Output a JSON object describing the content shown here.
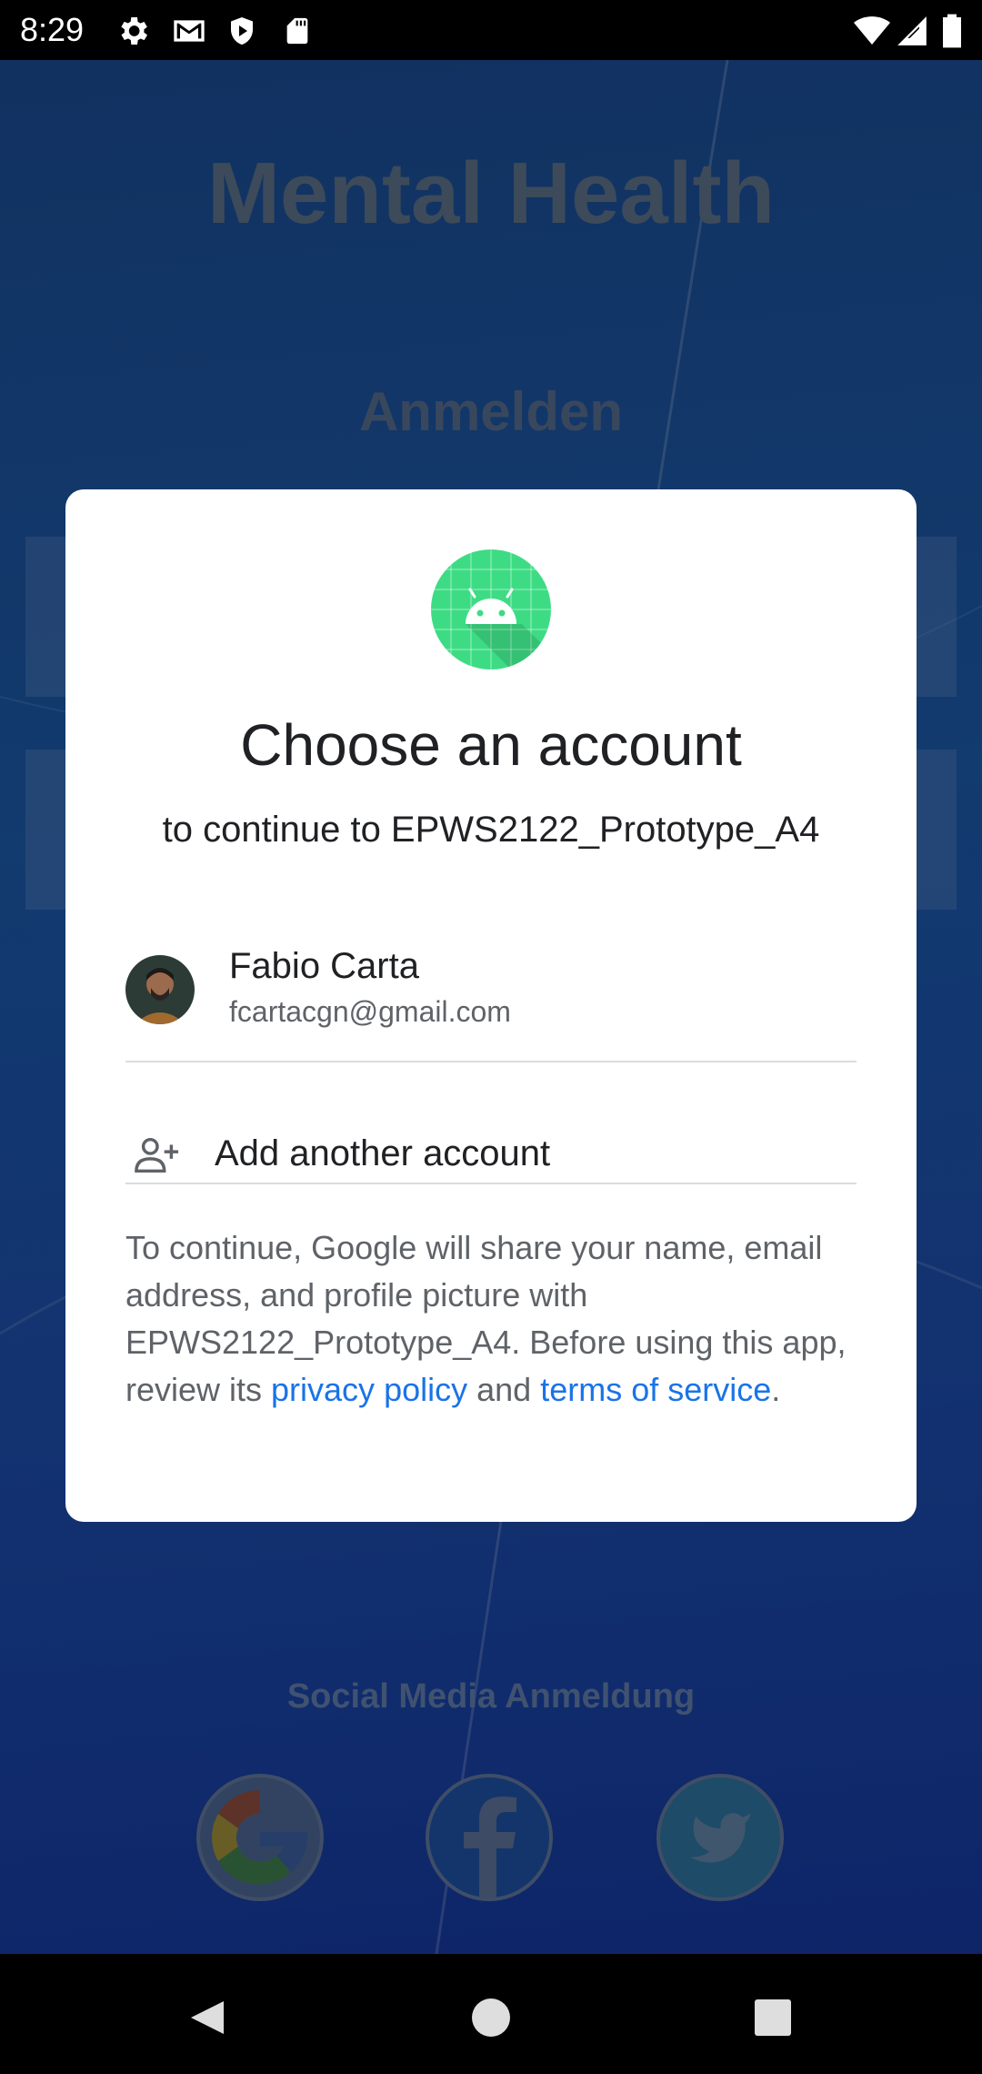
{
  "status_bar": {
    "time": "8:29",
    "left_icons": [
      "settings-icon",
      "gmail-icon",
      "play-protect-icon",
      "sd-card-icon"
    ],
    "right_icons": [
      "wifi-icon",
      "cellular-signal-icon",
      "battery-icon"
    ]
  },
  "background_app": {
    "title": "Mental Health",
    "login_heading": "Anmelden",
    "social_heading": "Social Media Anmeldung",
    "social_buttons": [
      {
        "name": "google-login-button",
        "icon": "google-icon"
      },
      {
        "name": "facebook-login-button",
        "icon": "facebook-icon"
      },
      {
        "name": "twitter-login-button",
        "icon": "twitter-icon"
      }
    ]
  },
  "dialog": {
    "app_icon": "android-app-icon",
    "title": "Choose an account",
    "subtitle": "to continue to EPWS2122_Prototype_A4",
    "account": {
      "name": "Fabio Carta",
      "email": "fcartacgn@gmail.com"
    },
    "add_account_label": "Add another account",
    "consent": {
      "text_before": "To continue, Google will share your name, email address, and profile picture with EPWS2122_Prototype_A4. Before using this app, review its ",
      "privacy_link": "privacy policy",
      "text_and": " and ",
      "terms_link": "terms of service",
      "text_end": "."
    }
  },
  "nav_bar": {
    "buttons": [
      "back-icon",
      "home-icon",
      "recents-icon"
    ]
  },
  "colors": {
    "dialog_bg": "#ffffff",
    "link": "#1a73e8",
    "android_green": "#3ddc84",
    "app_background": "#1b57a4"
  }
}
